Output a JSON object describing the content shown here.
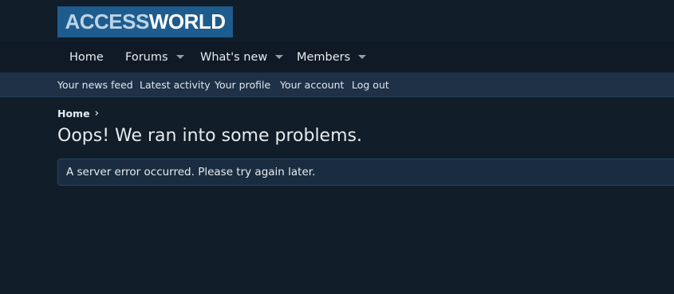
{
  "logo": {
    "part1": "ACCESS",
    "part2": "WORLD"
  },
  "nav": {
    "home": "Home",
    "forums": "Forums",
    "whats_new": "What's new",
    "members": "Members"
  },
  "subnav": {
    "news_feed": "Your news feed",
    "latest_activity": "Latest activity",
    "profile": "Your profile",
    "account": "Your account",
    "logout": "Log out"
  },
  "breadcrumb": {
    "home": "Home",
    "separator": "›"
  },
  "page": {
    "title": "Oops! We ran into some problems.",
    "error_message": "A server error occurred. Please try again later."
  },
  "colors": {
    "background": "#111d29",
    "logo_bg": "#1e5c8e",
    "subnav_bg": "#1e3146",
    "error_box_bg": "#1a2d40"
  }
}
